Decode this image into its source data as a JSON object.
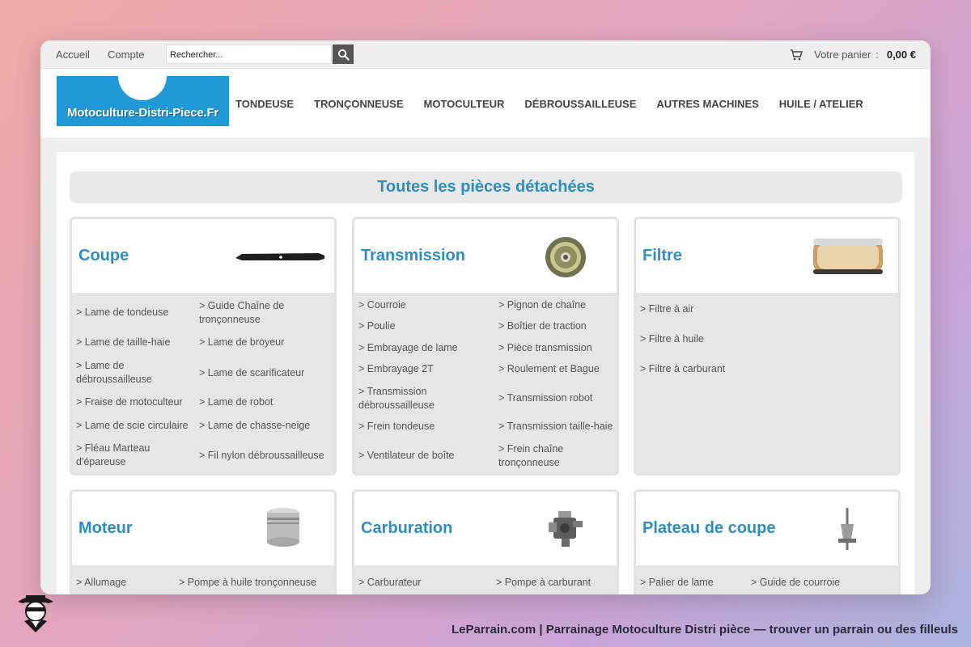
{
  "topbar": {
    "home": "Accueil",
    "account": "Compte",
    "search_value": "Rechercher...",
    "cart_label": "Votre panier",
    "cart_sep": ":",
    "cart_total": "0,00 €"
  },
  "logo": {
    "text": "Motoculture-Distri-Piece.Fr"
  },
  "nav": [
    "TONDEUSE",
    "TRONÇONNEUSE",
    "MOTOCULTEUR",
    "DÉBROUSSAILLEUSE",
    "AUTRES MACHINES",
    "HUILE / ATELIER"
  ],
  "banner": "Toutes les pièces détachées",
  "categories": [
    {
      "title": "Coupe",
      "icon": "mower-blade-icon",
      "left": [
        "> Lame de tondeuse",
        "> Lame de taille-haie",
        "> Lame de débroussailleuse",
        "> Fraise de motoculteur",
        "> Lame de scie circulaire",
        "> Fléau Marteau d'épareuse"
      ],
      "right": [
        "> Guide Chaîne de tronçonneuse",
        "> Lame de broyeur",
        "> Lame de scarificateur",
        "> Lame de robot",
        "> Lame de chasse-neige",
        "> Fil nylon débroussailleuse"
      ]
    },
    {
      "title": "Transmission",
      "icon": "pulley-icon",
      "left": [
        "> Courroie",
        "> Poulie",
        "> Embrayage de lame",
        "> Embrayage 2T",
        "> Transmission débroussailleuse",
        "> Frein tondeuse",
        "> Ventilateur de boîte"
      ],
      "right": [
        "> Pignon de chaîne",
        "> Boîtier de traction",
        "> Pièce transmission",
        "> Roulement et Bague",
        "> Transmission robot",
        "> Transmission taille-haie",
        "> Frein chaîne tronçonneuse"
      ]
    },
    {
      "title": "Filtre",
      "icon": "air-filter-icon",
      "left": [
        "> Filtre à air",
        "> Filtre à huile",
        "> Filtre à carburant"
      ]
    },
    {
      "title": "Moteur",
      "icon": "piston-icon",
      "left": [
        "> Allumage"
      ],
      "right": [
        "> Pompe à huile tronçonneuse"
      ]
    },
    {
      "title": "Carburation",
      "icon": "carburetor-icon",
      "left": [
        "> Carburateur"
      ],
      "right": [
        "> Pompe à carburant"
      ]
    },
    {
      "title": "Plateau de coupe",
      "icon": "spindle-icon",
      "left": [
        "> Palier de lame"
      ],
      "right": [
        "> Guide de courroie"
      ]
    }
  ],
  "footer": "LeParrain.com | Parrainage Motoculture Distri pièce — trouver un parrain ou des filleuls",
  "colors": {
    "accent": "#2b8fc6",
    "logo_bg": "#1f9ad6"
  }
}
